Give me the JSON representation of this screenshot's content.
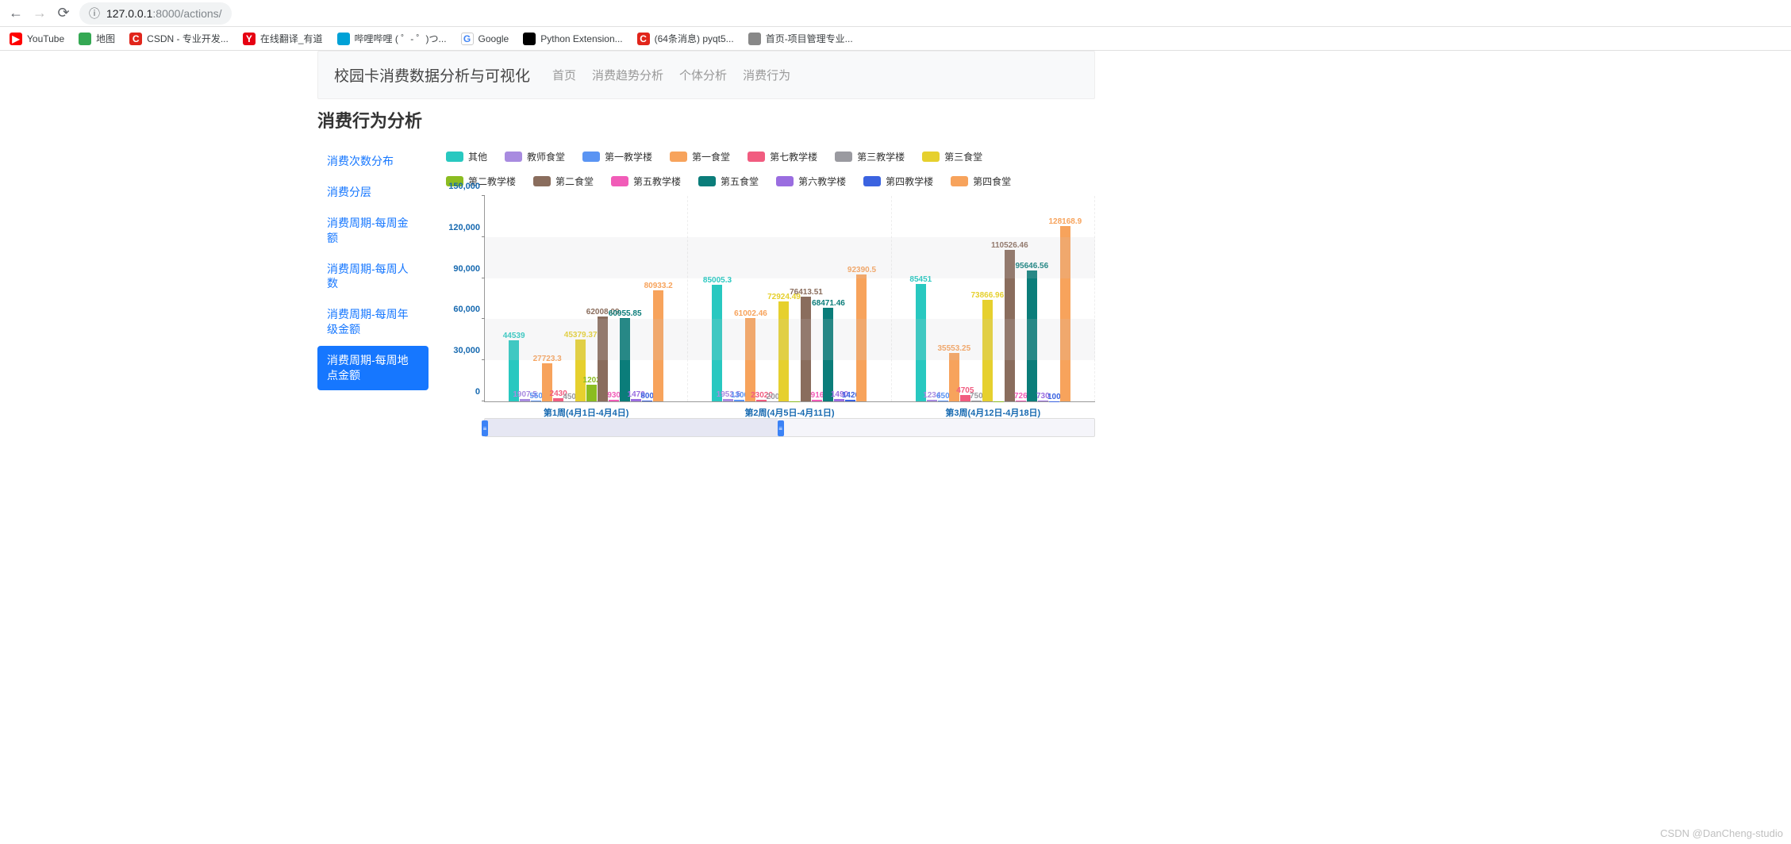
{
  "browser": {
    "url_host": "127.0.0.1",
    "url_port": ":8000",
    "url_path": "/actions/"
  },
  "bookmarks": [
    {
      "label": "YouTube",
      "icon_bg": "#ff0000",
      "icon_text": "▶"
    },
    {
      "label": "地图",
      "icon_bg": "#34a853",
      "icon_text": ""
    },
    {
      "label": "CSDN - 专业开发...",
      "icon_bg": "#e1251b",
      "icon_text": "C"
    },
    {
      "label": "在线翻译_有道",
      "icon_bg": "#e60012",
      "icon_text": "Y"
    },
    {
      "label": "哔哩哔哩 (  ゜- ゜)つ...",
      "icon_bg": "#00a1d6",
      "icon_text": ""
    },
    {
      "label": "Google",
      "icon_bg": "#ffffff",
      "icon_text": "G"
    },
    {
      "label": "Python Extension...",
      "icon_bg": "#000000",
      "icon_text": ""
    },
    {
      "label": "(64条消息) pyqt5...",
      "icon_bg": "#e1251b",
      "icon_text": "C"
    },
    {
      "label": "首页-项目管理专业...",
      "icon_bg": "#888888",
      "icon_text": ""
    }
  ],
  "header": {
    "brand": "校园卡消费数据分析与可视化",
    "nav": [
      "首页",
      "消费趋势分析",
      "个体分析",
      "消费行为"
    ]
  },
  "page_title": "消费行为分析",
  "sidebar": [
    {
      "label": "消费次数分布",
      "active": false
    },
    {
      "label": "消费分层",
      "active": false
    },
    {
      "label": "消费周期-每周金额",
      "active": false
    },
    {
      "label": "消费周期-每周人数",
      "active": false
    },
    {
      "label": "消费周期-每周年级金额",
      "active": false
    },
    {
      "label": "消费周期-每周地点金额",
      "active": true
    }
  ],
  "chart_data": {
    "type": "bar",
    "ylim": [
      0,
      150000
    ],
    "yticks": [
      0,
      30000,
      60000,
      90000,
      120000,
      150000
    ],
    "ytick_labels": [
      "0",
      "30,000",
      "60,000",
      "90,000",
      "120,000",
      "150,000"
    ],
    "categories": [
      "第1周(4月1日-4月4日)",
      "第2周(4月5日-4月11日)",
      "第3周(4月12日-4月18日)"
    ],
    "series": [
      {
        "name": "其他",
        "color": "#28c8c0",
        "values": [
          44539,
          85005.3,
          85451
        ],
        "labels": [
          "44539",
          "85005.3",
          "85451"
        ]
      },
      {
        "name": "教师食堂",
        "color": "#a88be0",
        "values": [
          1907.5,
          1952.5,
          1234
        ],
        "labels": [
          "1907.5",
          "1952.5",
          "1234"
        ]
      },
      {
        "name": "第一教学楼",
        "color": "#5a94f3",
        "values": [
          550,
          1300,
          650
        ],
        "labels": [
          "550",
          "1300",
          "650"
        ]
      },
      {
        "name": "第一食堂",
        "color": "#f7a35c",
        "values": [
          27723.3,
          61002.46,
          35553.25
        ],
        "labels": [
          "27723.3",
          "61002.46",
          "35553.25"
        ]
      },
      {
        "name": "第七教学楼",
        "color": "#f15c80",
        "values": [
          2430,
          1320,
          4705
        ],
        "labels": [
          "2430",
          "23020",
          "4705"
        ]
      },
      {
        "name": "第三教学楼",
        "color": "#9a9aa0",
        "values": [
          150,
          200,
          750
        ],
        "labels": [
          "450",
          "200",
          "750"
        ]
      },
      {
        "name": "第三食堂",
        "color": "#e6d02e",
        "values": [
          45379.37,
          72924.49,
          73866.96
        ],
        "labels": [
          "45379.37",
          "72924.49",
          "73866.96"
        ]
      },
      {
        "name": "第二教学楼",
        "color": "#8bbc21",
        "values": [
          12020,
          200,
          200
        ],
        "labels": [
          "1202",
          "",
          ""
        ]
      },
      {
        "name": "第二食堂",
        "color": "#8a6d5d",
        "values": [
          62008.09,
          76413.51,
          110526.46
        ],
        "labels": [
          "62008.09",
          "76413.51",
          "110526.46"
        ]
      },
      {
        "name": "第五教学楼",
        "color": "#f15cb8",
        "values": [
          930,
          916,
          726
        ],
        "labels": [
          "930",
          "916",
          "726"
        ]
      },
      {
        "name": "第五食堂",
        "color": "#0b7d7a",
        "values": [
          60955.85,
          68471.46,
          95646.56
        ],
        "labels": [
          "60955.85",
          "68471.46",
          "95646.56"
        ]
      },
      {
        "name": "第六教学楼",
        "color": "#9a6de0",
        "values": [
          1470,
          1490,
          730
        ],
        "labels": [
          "1470",
          "1490",
          "730"
        ]
      },
      {
        "name": "第四教学楼",
        "color": "#3b63e0",
        "values": [
          800,
          1420,
          100
        ],
        "labels": [
          "800",
          "1420",
          "100"
        ]
      },
      {
        "name": "第四食堂",
        "color": "#f7a35c",
        "values": [
          80933.2,
          92390.5,
          128168.9
        ],
        "labels": [
          "80933.2",
          "92390.5",
          "128168.9"
        ]
      }
    ]
  },
  "watermark": "CSDN @DanCheng-studio"
}
